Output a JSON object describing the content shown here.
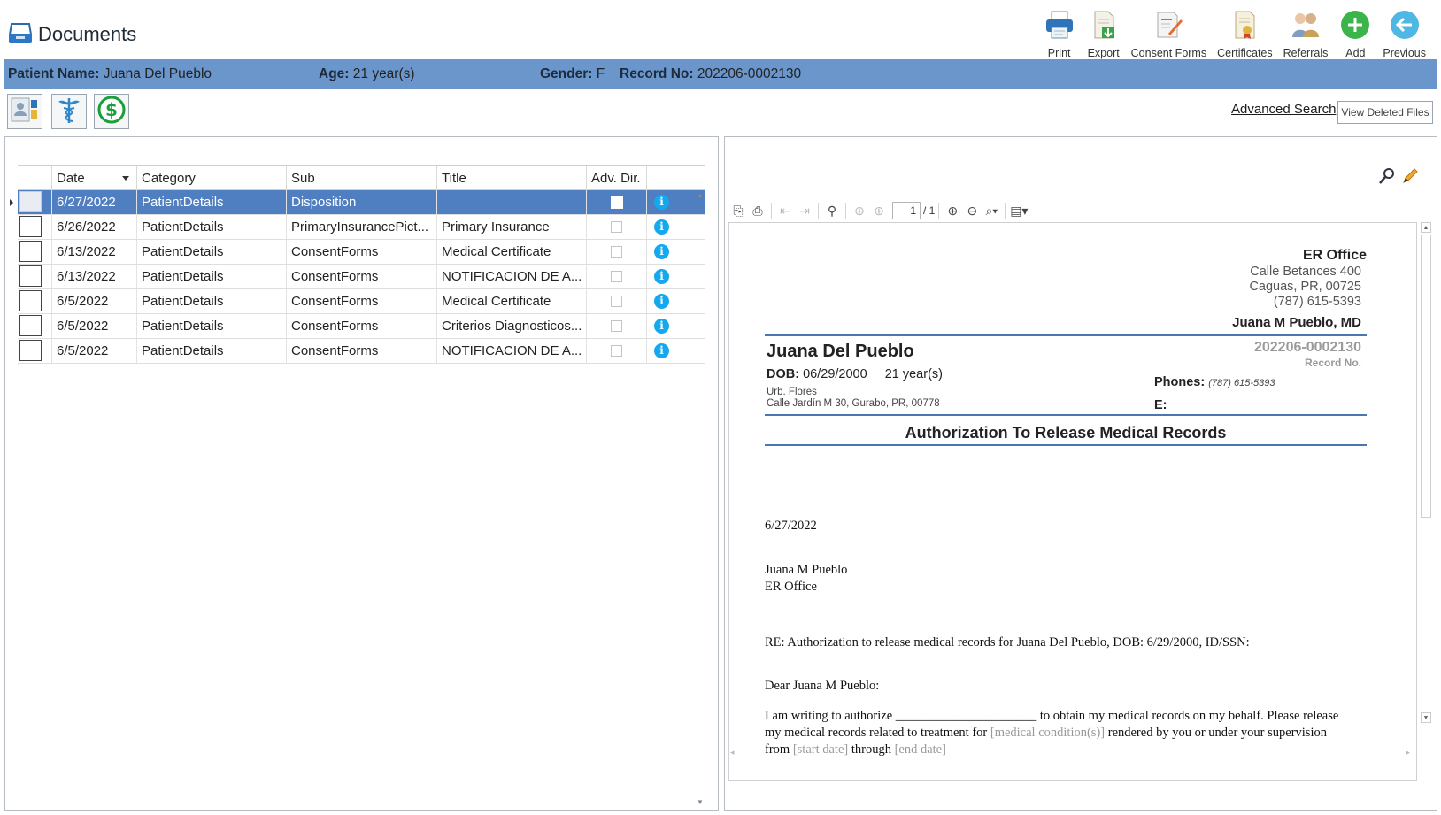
{
  "app": {
    "title": "Documents"
  },
  "toolbar": [
    {
      "label": "Print",
      "icon": "printer-icon"
    },
    {
      "label": "Export",
      "icon": "export-icon"
    },
    {
      "label": "Consent Forms",
      "icon": "consent-forms-icon"
    },
    {
      "label": "Certificates",
      "icon": "certificate-icon"
    },
    {
      "label": "Referrals",
      "icon": "referrals-icon"
    },
    {
      "label": "Add",
      "icon": "add-icon"
    },
    {
      "label": "Previous",
      "icon": "back-arrow-icon"
    }
  ],
  "patient": {
    "name_label": "Patient Name:",
    "name": "Juana Del Pueblo",
    "age_label": "Age:",
    "age": "21 year(s)",
    "gender_label": "Gender:",
    "gender": "F",
    "record_label": "Record No:",
    "record": "202206-0002130"
  },
  "actions": {
    "advanced_search": "Advanced Search",
    "view_deleted": "View Deleted Files"
  },
  "grid": {
    "columns": [
      "Date",
      "Category",
      "Sub",
      "Title",
      "Adv. Dir."
    ],
    "rows": [
      {
        "date": "6/27/2022",
        "category": "PatientDetails",
        "sub": "Disposition",
        "title": "",
        "selected": true
      },
      {
        "date": "6/26/2022",
        "category": "PatientDetails",
        "sub": "PrimaryInsurancePict...",
        "title": "Primary Insurance",
        "selected": false
      },
      {
        "date": "6/13/2022",
        "category": "PatientDetails",
        "sub": "ConsentForms",
        "title": "Medical Certificate",
        "selected": false
      },
      {
        "date": "6/13/2022",
        "category": "PatientDetails",
        "sub": "ConsentForms",
        "title": "NOTIFICACION DE A...",
        "selected": false
      },
      {
        "date": "6/5/2022",
        "category": "PatientDetails",
        "sub": "ConsentForms",
        "title": "Medical Certificate",
        "selected": false
      },
      {
        "date": "6/5/2022",
        "category": "PatientDetails",
        "sub": "ConsentForms",
        "title": "Criterios Diagnosticos...",
        "selected": false
      },
      {
        "date": "6/5/2022",
        "category": "PatientDetails",
        "sub": "ConsentForms",
        "title": "NOTIFICACION DE A...",
        "selected": false
      }
    ]
  },
  "viewer": {
    "page_current": "1",
    "page_total": "/ 1"
  },
  "document": {
    "office": "ER Office",
    "address1": "Calle Betances 400",
    "address2": "Caguas, PR, 00725",
    "office_phone": "(787) 615-5393",
    "doctor": "Juana M Pueblo, MD",
    "patient_name": "Juana Del Pueblo",
    "record_no": "202206-0002130",
    "record_no_label": "Record No.",
    "dob_label": "DOB:",
    "dob": "06/29/2000",
    "age": "21 year(s)",
    "phones_label": "Phones:",
    "phones": "(787) 615-5393",
    "email_label": "E:",
    "patient_addr1": "Urb. Flores",
    "patient_addr2": "Calle Jardín M 30, Gurabo, PR, 00778",
    "heading": "Authorization To Release Medical Records",
    "date": "6/27/2022",
    "to_name": "Juana M Pueblo",
    "to_office": "ER Office",
    "re_line": "RE: Authorization to release medical records for Juana Del Pueblo, DOB: 6/29/2000, ID/SSN:",
    "salutation": "Dear Juana M Pueblo:",
    "body1": "I am writing to authorize ______________________ to obtain my medical records on my behalf. Please release",
    "body2a": "my medical records related to treatment for ",
    "body2_ph": "[medical condition(s)]",
    "body2b": " rendered by you or under your supervision",
    "body3a": "from ",
    "body3_ph1": "[start date]",
    "body3b": " through ",
    "body3_ph2": "[end date]"
  }
}
